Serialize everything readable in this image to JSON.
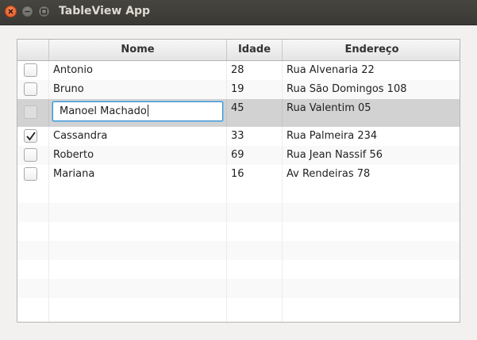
{
  "window": {
    "title": "TableView App"
  },
  "table": {
    "columns": [
      "",
      "Nome",
      "Idade",
      "Endereço"
    ],
    "rows": [
      {
        "checked": false,
        "nome": "Antonio",
        "idade": "28",
        "endereco": "Rua Alvenaria 22"
      },
      {
        "checked": false,
        "nome": "Bruno",
        "idade": "19",
        "endereco": "Rua São Domingos 108"
      },
      {
        "checked": false,
        "nome": "Manoel Machado",
        "idade": "45",
        "endereco": "Rua Valentim 05",
        "editing": true
      },
      {
        "checked": true,
        "nome": "Cassandra",
        "idade": "33",
        "endereco": "Rua Palmeira 234"
      },
      {
        "checked": false,
        "nome": "Roberto",
        "idade": "69",
        "endereco": "Rua Jean Nassif 56"
      },
      {
        "checked": false,
        "nome": "Mariana",
        "idade": "16",
        "endereco": "Av Rendeiras 78"
      }
    ]
  },
  "colors": {
    "titlebar": "#3c3b37",
    "close_button": "#e95420",
    "selection": "#d2d2d2",
    "focus_border": "#3a8fc9"
  },
  "icons": {
    "close": "close-icon",
    "minimize": "minimize-icon",
    "maximize": "maximize-icon",
    "check": "check-icon"
  }
}
